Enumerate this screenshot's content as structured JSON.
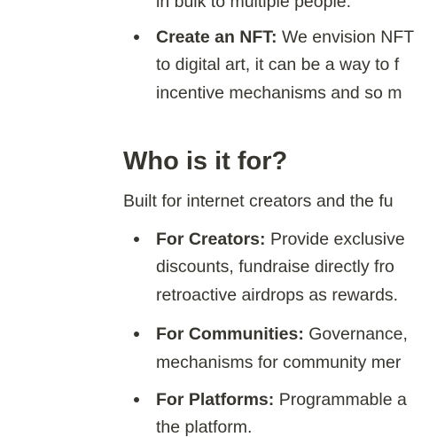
{
  "section_top": {
    "prev_item_tail": "in bulk to multiple people.",
    "nft_item": {
      "label": "Create an NFT:",
      "line1": "We envision NFT",
      "line2": "to digital art, it can be a way to f",
      "line3": "incentive mechanisms and so m"
    }
  },
  "section_who": {
    "heading": "Who is it for?",
    "intro": "Built for internet creators and the fu",
    "items": [
      {
        "label": "For Creators:",
        "line1": "Provide exclusive",
        "line2": "discounts, fundraise directly fro",
        "line3": "retroactive airdrops as rewards."
      },
      {
        "label": "For Communities:",
        "line1": "Governance,",
        "line2": "mechanisms for community mer"
      },
      {
        "label": "For Platforms:",
        "line1": "Programmable a",
        "line2": "the platform."
      }
    ]
  }
}
